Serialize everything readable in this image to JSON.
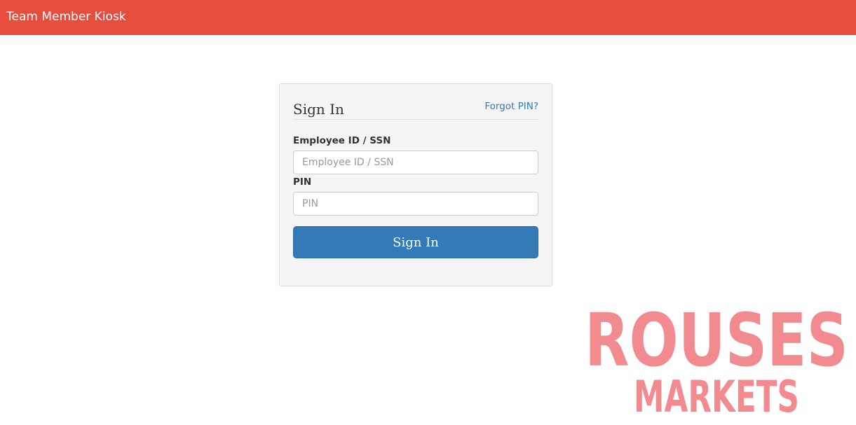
{
  "header": {
    "title": "Team Member Kiosk",
    "color": "#e74c3c"
  },
  "signin": {
    "title": "Sign In",
    "forgot_label": "Forgot PIN?",
    "employee_label": "Employee ID / SSN",
    "employee_placeholder": "Employee ID / SSN",
    "employee_value": "",
    "pin_label": "PIN",
    "pin_placeholder": "PIN",
    "pin_value": "",
    "submit_label": "Sign In",
    "button_color": "#337ab7"
  },
  "logo": {
    "line1": "ROUSES",
    "line2": "MARKETS",
    "color": "#f28b8f"
  }
}
